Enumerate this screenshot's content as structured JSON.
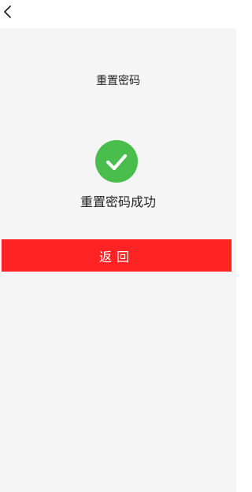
{
  "header": {
    "back_icon": "chevron-left-icon"
  },
  "main": {
    "title": "重置密码",
    "status": {
      "icon": "check-circle-icon",
      "text": "重置密码成功",
      "color": "#49be4c"
    },
    "primary_button": {
      "label": "返回",
      "color": "#ff2323"
    }
  },
  "theme": {
    "background": "#f5f5f6",
    "topbar_background": "#ffffff"
  }
}
